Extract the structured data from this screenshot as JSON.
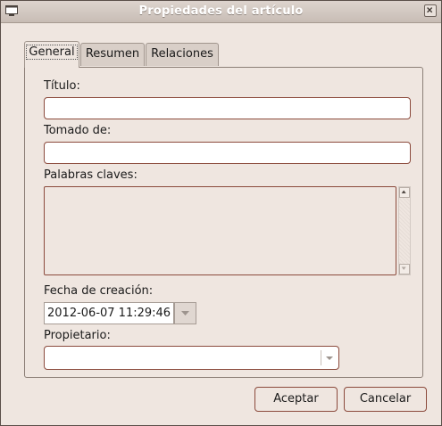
{
  "window": {
    "title": "Propiedades del artículo"
  },
  "tabs": [
    {
      "label": "General",
      "active": true
    },
    {
      "label": "Resumen",
      "active": false
    },
    {
      "label": "Relaciones",
      "active": false
    }
  ],
  "form": {
    "titulo_label": "Título:",
    "titulo_value": "",
    "tomado_label": "Tomado de:",
    "tomado_value": "",
    "palabras_label": "Palabras claves:",
    "palabras_value": "",
    "fecha_label": "Fecha de creación:",
    "fecha_value": "2012-06-07 11:29:46",
    "propietario_label": "Propietario:",
    "propietario_value": ""
  },
  "buttons": {
    "ok_label": "Aceptar",
    "cancel_label": "Cancelar"
  },
  "colors": {
    "window_bg": "#efe6e0",
    "field_border": "#8b4a3c",
    "titlebar_text": "#ffffff"
  },
  "icons": [
    "window-menu-icon",
    "close-icon",
    "scroll-up-icon",
    "scroll-down-icon",
    "dropdown-arrow-icon"
  ]
}
